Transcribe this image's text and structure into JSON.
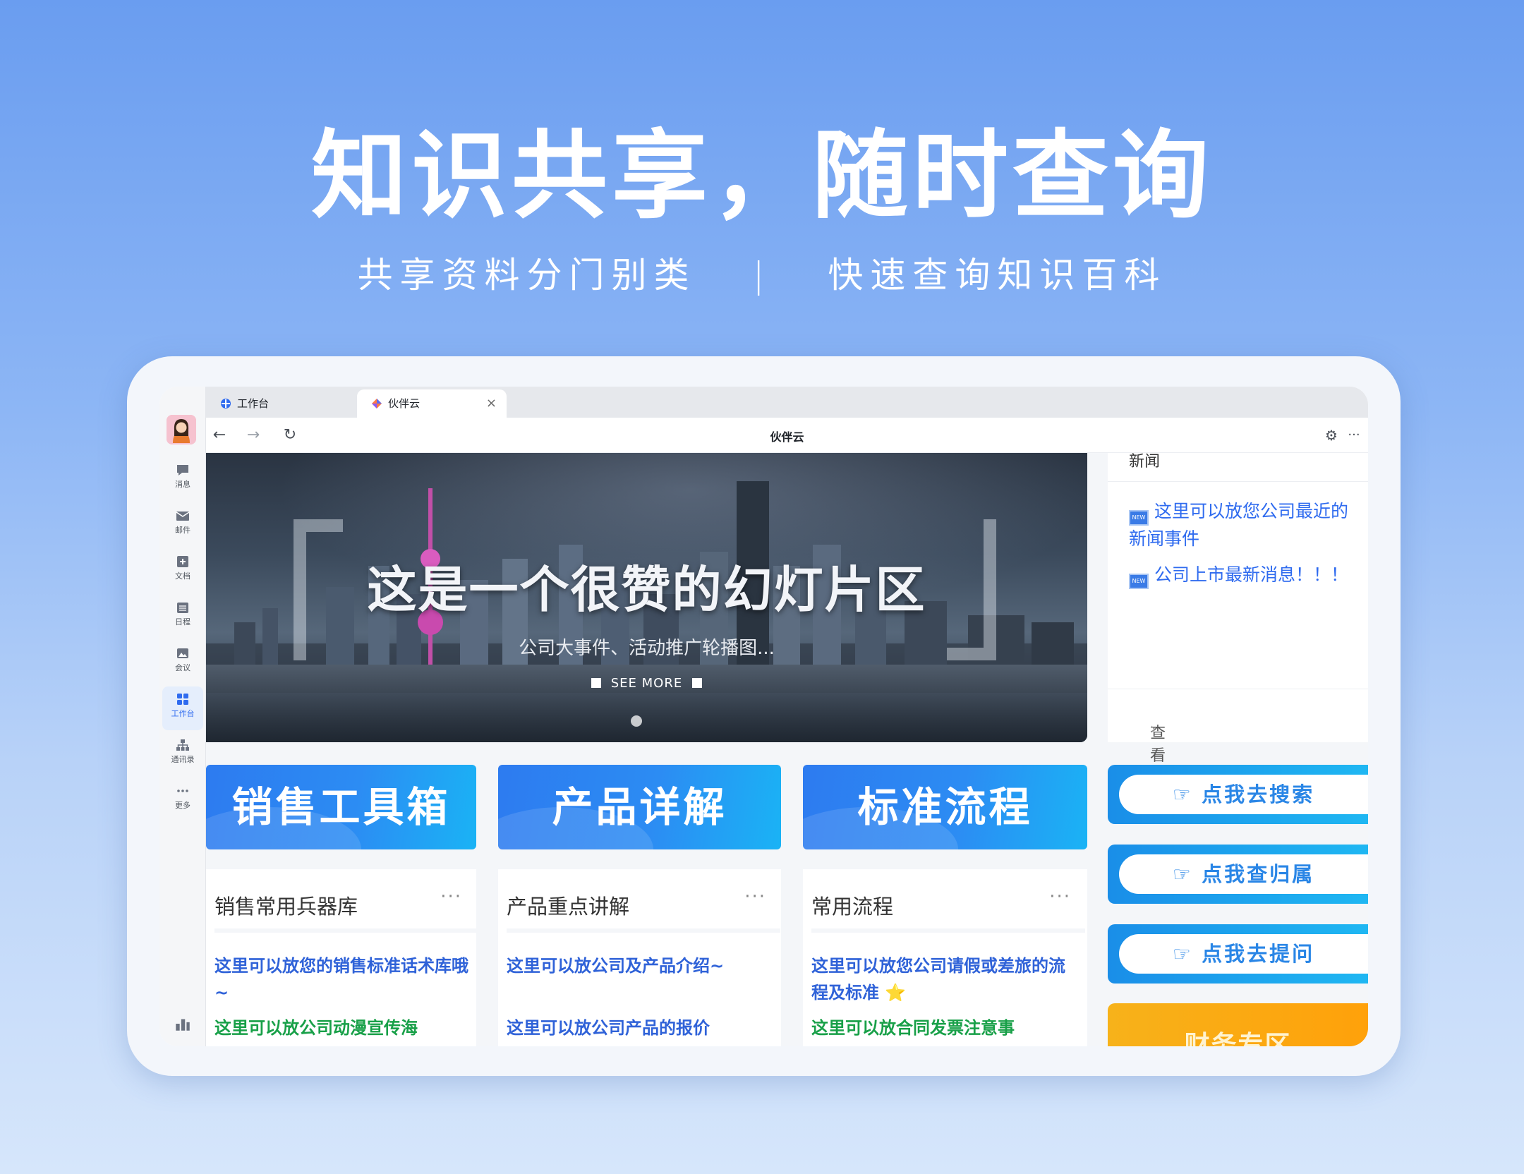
{
  "hero": {
    "title": "知识共享，随时查询",
    "subtitle_left": "共享资料分门别类",
    "subtitle_sep": "|",
    "subtitle_right": "快速查询知识百科"
  },
  "sidebar": {
    "items": [
      {
        "label": "消息",
        "icon": "chat-bubble-icon"
      },
      {
        "label": "邮件",
        "icon": "mail-icon"
      },
      {
        "label": "文档",
        "icon": "document-icon"
      },
      {
        "label": "日程",
        "icon": "calendar-icon"
      },
      {
        "label": "会议",
        "icon": "meeting-icon"
      },
      {
        "label": "工作台",
        "icon": "grid-icon",
        "active": true
      },
      {
        "label": "通讯录",
        "icon": "org-chart-icon"
      },
      {
        "label": "更多",
        "icon": "more-dots-icon"
      }
    ]
  },
  "browser": {
    "tabs": [
      {
        "label": "工作台",
        "icon": "workbench-icon"
      },
      {
        "label": "伙伴云",
        "icon": "huobanyun-icon",
        "close": "×"
      }
    ],
    "title": "伙伴云",
    "back": "←",
    "forward": "→",
    "reload": "↻",
    "settings_icon": "⚙",
    "more": "···"
  },
  "banner": {
    "title": "这是一个很赞的幻灯片区",
    "subtitle": "公司大事件、活动推广轮播图...",
    "more": "SEE MORE"
  },
  "news": {
    "heading": "新闻",
    "badge": "NEW",
    "items": [
      "这里可以放您公司最近的新闻事件",
      "公司上市最新消息！！！"
    ],
    "footer": "查看详情",
    "footer_arrow": "›"
  },
  "categories": [
    "销售工具箱",
    "产品详解",
    "标准流程"
  ],
  "cards": [
    {
      "title": "销售常用兵器库",
      "more": "···",
      "line1": "这里可以放您的销售标准话术库哦~",
      "line2": "这里可以放公司动漫宣传海"
    },
    {
      "title": "产品重点讲解",
      "more": "···",
      "line1": "这里可以放公司及产品介绍~",
      "line2": "这里可以放公司产品的报价"
    },
    {
      "title": "常用流程",
      "more": "···",
      "line1": "这里可以放您公司请假或差旅的流程及标准",
      "line1_emoji": "⭐",
      "line2": "这里可以放合同发票注意事"
    }
  ],
  "quick_actions": [
    "点我去搜索",
    "点我查归属",
    "点我去提问"
  ],
  "finance": "财务专区",
  "colors": {
    "accent": "#2f6bef",
    "category_gradient_start": "#2d7bf0",
    "category_gradient_end": "#1ab3f5",
    "green_text": "#18a048",
    "finance": "#f7b21a"
  }
}
